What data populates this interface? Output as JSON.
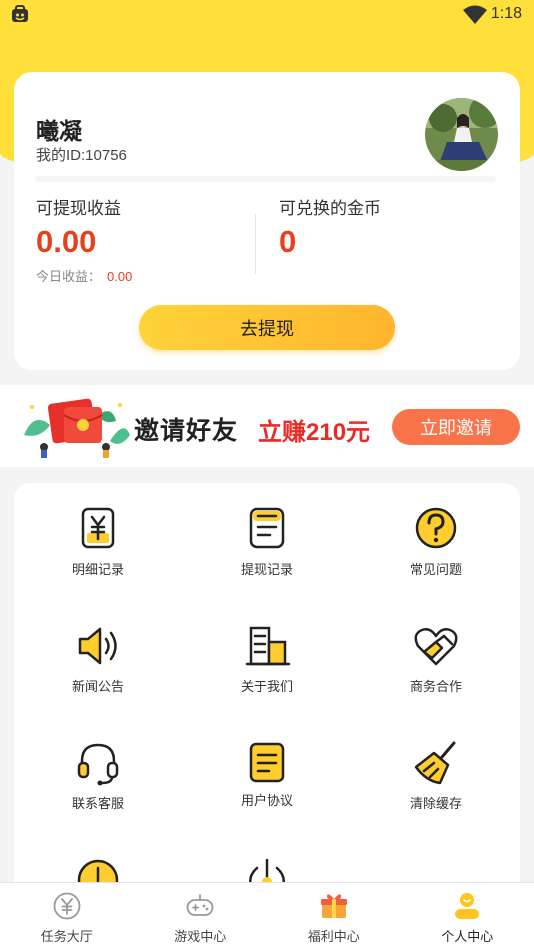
{
  "status_bar": {
    "time": "1:18"
  },
  "profile": {
    "username": "曦凝",
    "user_id": "我的ID:10756",
    "withdrawable_label": "可提现收益",
    "withdrawable_value": "0.00",
    "today_label": "今日收益：",
    "today_value": "0.00",
    "coins_label": "可兑换的金币",
    "coins_value": "0",
    "withdraw_button": "去提现"
  },
  "invite": {
    "title": "邀请好友",
    "reward": "立赚210元",
    "button": "立即邀请"
  },
  "menu": {
    "items": [
      {
        "label": "明细记录",
        "icon": "yuan-record-icon"
      },
      {
        "label": "提现记录",
        "icon": "withdraw-record-icon"
      },
      {
        "label": "常见问题",
        "icon": "question-icon"
      },
      {
        "label": "新闻公告",
        "icon": "speaker-icon"
      },
      {
        "label": "关于我们",
        "icon": "building-icon"
      },
      {
        "label": "商务合作",
        "icon": "handshake-icon"
      },
      {
        "label": "联系客服",
        "icon": "headset-icon"
      },
      {
        "label": "用户协议",
        "icon": "document-icon"
      },
      {
        "label": "清除缓存",
        "icon": "broom-icon"
      }
    ]
  },
  "tabs": [
    {
      "label": "任务大厅",
      "icon": "yuan-coin-icon"
    },
    {
      "label": "游戏中心",
      "icon": "gamepad-icon"
    },
    {
      "label": "福利中心",
      "icon": "gift-icon"
    },
    {
      "label": "个人中心",
      "icon": "person-icon"
    }
  ],
  "colors": {
    "brand_yellow": "#ffdf3a",
    "accent_red": "#e8401c",
    "invite_orange": "#f9744a"
  }
}
